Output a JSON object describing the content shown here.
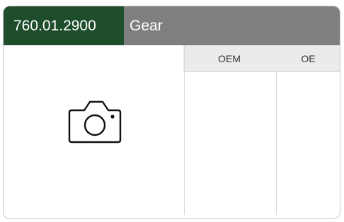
{
  "header": {
    "part_number": "760.01.2900",
    "part_name": "Gear"
  },
  "image_placeholder": {
    "icon": "camera-icon"
  },
  "table": {
    "columns": [
      "OEM",
      "OE"
    ]
  },
  "colors": {
    "part_number_bg": "#1e4d2b",
    "header_bg": "#7f7f7f",
    "column_header_bg": "#ebebeb"
  }
}
